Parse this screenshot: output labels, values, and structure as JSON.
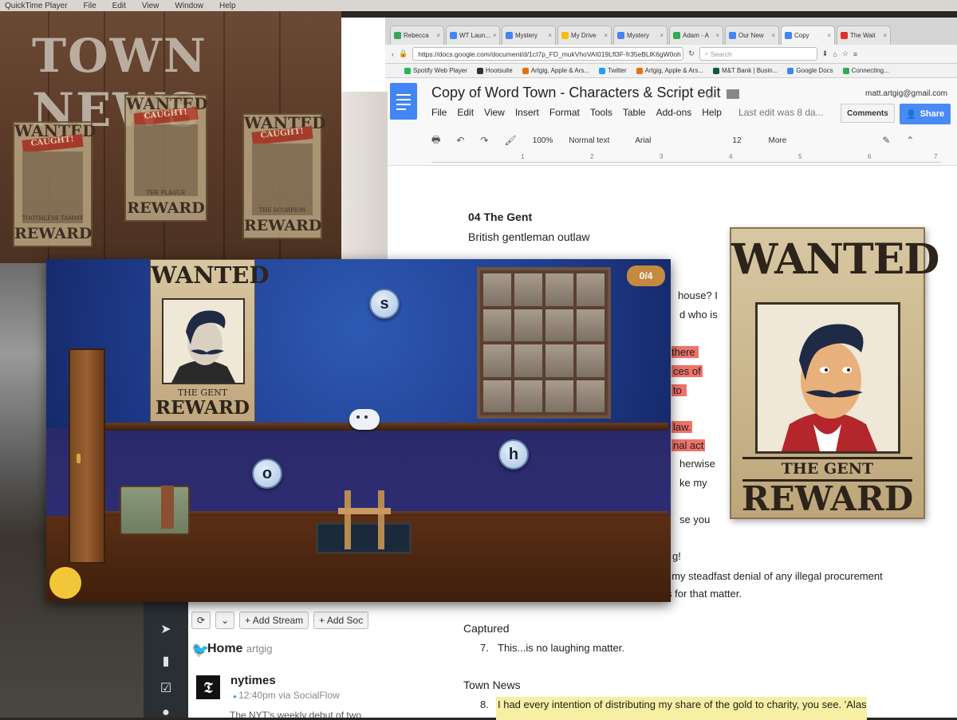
{
  "menubar": {
    "app": "QuickTime Player",
    "items": [
      "File",
      "Edit",
      "View",
      "Window",
      "Help"
    ]
  },
  "chrome": {
    "tabs": [
      {
        "label": "Rebecca",
        "color": "#34a853"
      },
      {
        "label": "WT Laun...",
        "color": "#4285f4"
      },
      {
        "label": "Mystery",
        "color": "#4285f4"
      },
      {
        "label": "My Drive",
        "color": "#fbbc05"
      },
      {
        "label": "Mystery",
        "color": "#4285f4"
      },
      {
        "label": "Adam - A",
        "color": "#34a853"
      },
      {
        "label": "Our New",
        "color": "#4285f4"
      },
      {
        "label": "Copy",
        "color": "#4285f4"
      },
      {
        "label": "The Wait",
        "color": "#e52d27"
      }
    ],
    "url": "https://docs.google.com/document/d/1cI7p_FD_mukVhoVAI019Lfl3F-fr35eBLlK6gW0oh",
    "search_placeholder": "Search",
    "bookmarks": [
      {
        "label": "Spotify Web Player",
        "color": "#1db954"
      },
      {
        "label": "Hootsuite",
        "color": "#333"
      },
      {
        "label": "Artgig, Apple & Ars...",
        "color": "#e8710a"
      },
      {
        "label": "Twitter",
        "color": "#1da1f2"
      },
      {
        "label": "Artgig, Apple & Ars...",
        "color": "#e8710a"
      },
      {
        "label": "M&T Bank | Busin...",
        "color": "#0b5a3a"
      },
      {
        "label": "Google Docs",
        "color": "#4285f4"
      },
      {
        "label": "Connecting...",
        "color": "#34a853"
      }
    ]
  },
  "docs": {
    "title": "Copy of Word Town - Characters & Script edit",
    "user": "matt.artgig@gmail.com",
    "menus": [
      "File",
      "Edit",
      "View",
      "Insert",
      "Format",
      "Tools",
      "Table",
      "Add-ons",
      "Help"
    ],
    "last_edit": "Last edit was 8 da...",
    "comments": "Comments",
    "share": "Share",
    "toolbar": {
      "zoom": "100%",
      "style": "Normal text",
      "font": "Arial",
      "size": "12",
      "more": "More"
    },
    "ruler": [
      "1",
      "2",
      "3",
      "4",
      "5",
      "6",
      "7"
    ],
    "body": {
      "heading": "04 The Gent",
      "subheading": "British gentleman outlaw",
      "frag1": "house? I",
      "frag2": "d who is",
      "frag3": "there",
      "frag4": "ces of",
      "frag5": "to",
      "frag6": "law.",
      "frag7": "nal act",
      "frag8": "herwise",
      "frag9": "ke my",
      "frag10": "se you",
      "frag11": "g!",
      "frag12": ", my steadfast denial of any illegal procurement",
      "frag13": "s for that matter.",
      "captured": "Captured",
      "line7_num": "7.",
      "line7": "This...is no laughing matter.",
      "townnews": "Town News",
      "line8_num": "8.",
      "line8": "I had every intention of distributing my share of the gold to charity, you see. 'Alas"
    },
    "poster": {
      "wanted": "WANTED",
      "name": "THE GENT",
      "reward": "REWARD"
    }
  },
  "townnews": {
    "title": "TOWN NEWS",
    "posters": [
      {
        "wanted": "WANTED",
        "caught": "CAUGHT!",
        "caption": "TOOTHLESS TAMMY",
        "reward": "REWARD"
      },
      {
        "wanted": "WANTED",
        "caught": "CAUGHT!",
        "caption": "THE PLAGUE",
        "reward": "REWARD"
      },
      {
        "wanted": "WANTED",
        "caught": "CAUGHT!",
        "caption": "THE SCORPION",
        "reward": "REWARD"
      }
    ]
  },
  "game": {
    "poster": {
      "wanted": "WANTED",
      "name": "THE GENT",
      "reward": "REWARD"
    },
    "counter": "0/4",
    "letters": [
      "s",
      "h",
      "o"
    ]
  },
  "hootsuite": {
    "refresh": "⟳",
    "dropdown": "⌄",
    "add_stream": "+ Add Stream",
    "add_social": "+ Add Soc",
    "home": "Home",
    "home_user": "artgig",
    "account": "nytimes",
    "meta": "12:40pm via SocialFlow",
    "body": "The NYT's weekly debut of two"
  }
}
